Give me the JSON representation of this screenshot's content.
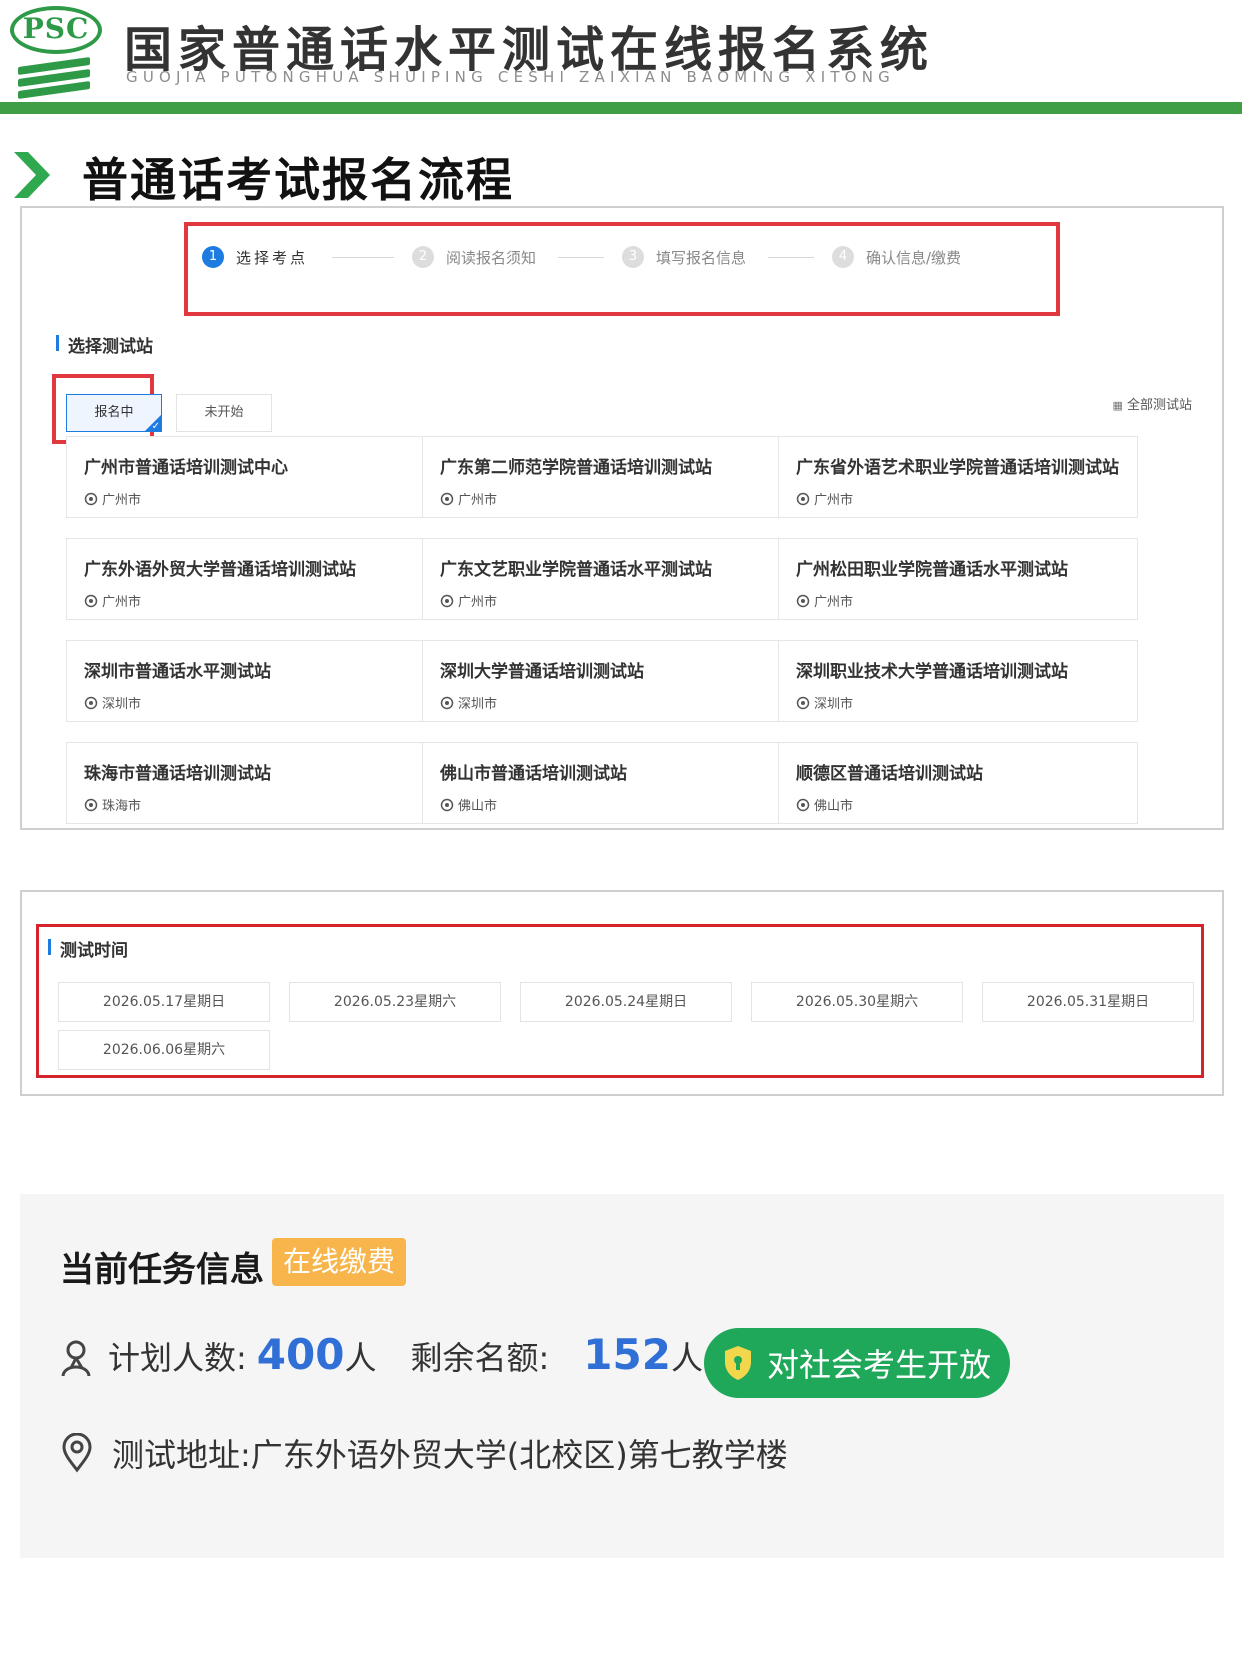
{
  "header": {
    "logo_text": "PSC",
    "title": "国家普通话水平测试在线报名系统",
    "pinyin": "GUOJIA PUTONGHUA SHUIPING CESHI ZAIXIAN BAOMING XITONG"
  },
  "section_title": "普通话考试报名流程",
  "steps": [
    {
      "num": "1",
      "label": "选择考点"
    },
    {
      "num": "2",
      "label": "阅读报名须知"
    },
    {
      "num": "3",
      "label": "填写报名信息"
    },
    {
      "num": "4",
      "label": "确认信息/缴费"
    }
  ],
  "site_select": {
    "heading": "选择测试站",
    "filters": [
      "报名中",
      "未开始"
    ],
    "all_sites": "全部测试站"
  },
  "sites": [
    {
      "name": "广州市普通话培训测试中心",
      "city": "广州市"
    },
    {
      "name": "广东第二师范学院普通话培训测试站",
      "city": "广州市"
    },
    {
      "name": "广东省外语艺术职业学院普通话培训测试站",
      "city": "广州市"
    },
    {
      "name": "广东外语外贸大学普通话培训测试站",
      "city": "广州市"
    },
    {
      "name": "广东文艺职业学院普通话水平测试站",
      "city": "广州市"
    },
    {
      "name": "广州松田职业学院普通话水平测试站",
      "city": "广州市"
    },
    {
      "name": "深圳市普通话水平测试站",
      "city": "深圳市"
    },
    {
      "name": "深圳大学普通话培训测试站",
      "city": "深圳市"
    },
    {
      "name": "深圳职业技术大学普通话培训测试站",
      "city": "深圳市"
    },
    {
      "name": "珠海市普通话培训测试站",
      "city": "珠海市"
    },
    {
      "name": "佛山市普通话培训测试站",
      "city": "佛山市"
    },
    {
      "name": "顺德区普通话培训测试站",
      "city": "佛山市"
    }
  ],
  "test_time": {
    "heading": "测试时间",
    "dates": [
      "2026.05.17星期日",
      "2026.05.23星期六",
      "2026.05.24星期日",
      "2026.05.30星期六",
      "2026.05.31星期日",
      "2026.06.06星期六"
    ]
  },
  "task": {
    "title": "当前任务信息",
    "badge": "在线缴费",
    "plan_label": "计划人数:",
    "plan_value": "400",
    "plan_unit": "人",
    "remain_label": "剩余名额:",
    "remain_value": "152",
    "remain_unit": "人",
    "open_label": "对社会考生开放",
    "address_label": "测试地址:",
    "address_value": "广东外语外贸大学(北校区)第七教学楼"
  },
  "colors": {
    "brand_green": "#3f9e46",
    "highlight_red": "#e0383e",
    "accent_blue": "#1e7be0",
    "number_blue": "#2f6fd6",
    "badge_orange": "#f7b54c",
    "open_green": "#1fa75a"
  },
  "icons": {
    "logo": "psc-logo-icon",
    "section": "chevron-right-icon",
    "location": "location-pin-icon",
    "people": "user-icon",
    "shield": "shield-icon",
    "grid": "grid-icon"
  }
}
